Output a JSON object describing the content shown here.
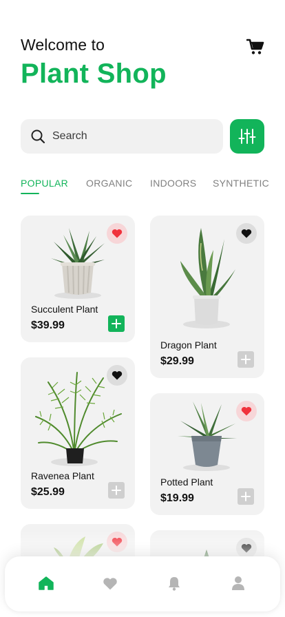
{
  "header": {
    "welcome": "Welcome to",
    "title": "Plant Shop",
    "cart_icon": "cart-icon"
  },
  "search": {
    "placeholder": "Search",
    "value": "",
    "search_icon": "search-icon",
    "filter_icon": "sliders-icon"
  },
  "tabs": [
    {
      "label": "POPULAR",
      "active": true
    },
    {
      "label": "ORGANIC",
      "active": false
    },
    {
      "label": "INDOORS",
      "active": false
    },
    {
      "label": "SYNTHETIC",
      "active": false
    }
  ],
  "products": [
    {
      "name": "Succulent Plant",
      "price": "$39.99",
      "favorite": true,
      "in_cart": true
    },
    {
      "name": "Dragon Plant",
      "price": "$29.99",
      "favorite": false,
      "in_cart": false
    },
    {
      "name": "Ravenea Plant",
      "price": "$25.99",
      "favorite": false,
      "in_cart": false
    },
    {
      "name": "Potted Plant",
      "price": "$19.99",
      "favorite": true,
      "in_cart": false
    }
  ],
  "bottom_nav": [
    {
      "icon": "home-icon",
      "active": true
    },
    {
      "icon": "heart-icon",
      "active": false
    },
    {
      "icon": "bell-icon",
      "active": false
    },
    {
      "icon": "user-icon",
      "active": false
    }
  ],
  "colors": {
    "accent": "#12b45a",
    "favorite": "#f0323c",
    "card": "#f2f2f2",
    "inactive": "#b5b5b5"
  }
}
